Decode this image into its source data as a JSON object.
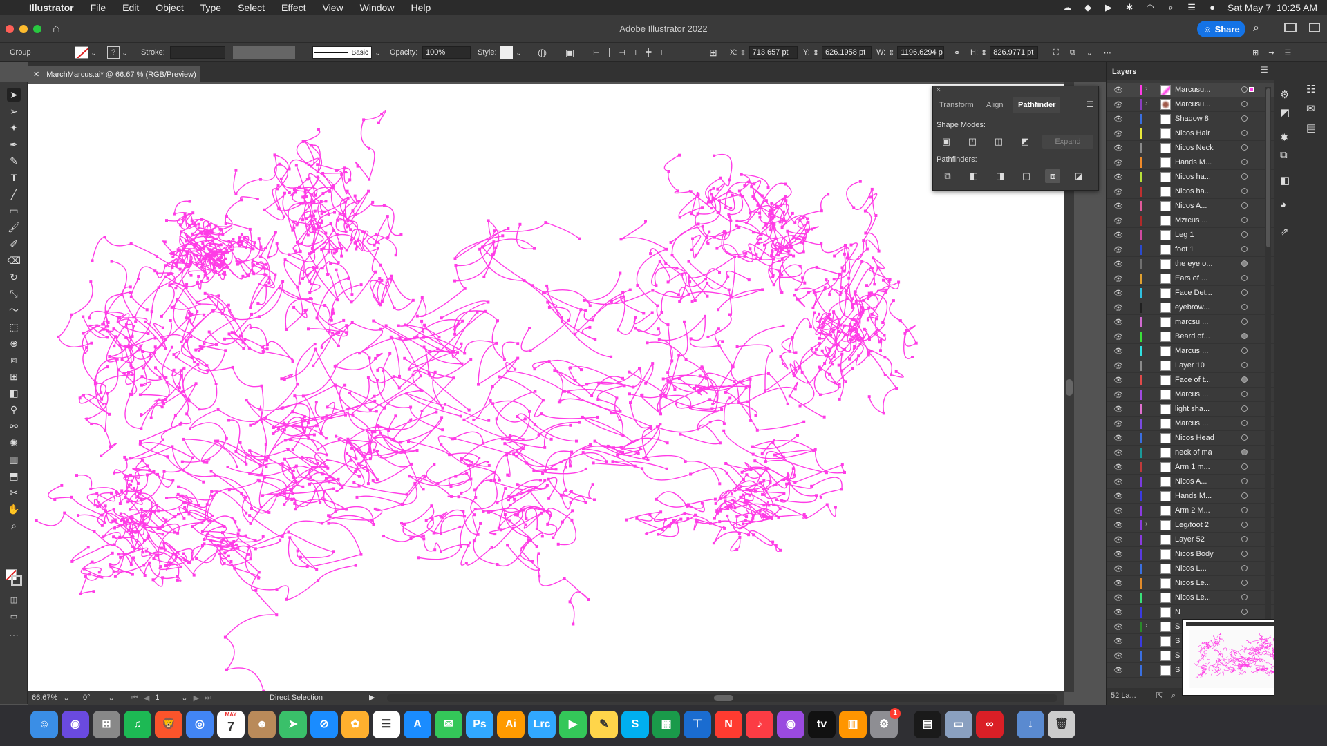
{
  "menubar": {
    "app": "Illustrator",
    "items": [
      "File",
      "Edit",
      "Object",
      "Type",
      "Select",
      "Effect",
      "View",
      "Window",
      "Help"
    ],
    "clock": "Sat May 7  10:25 AM"
  },
  "window": {
    "title": "Adobe Illustrator 2022",
    "share_label": "Share",
    "doc_tab": "MarchMarcus.ai* @ 66.67 % (RGB/Preview)"
  },
  "control": {
    "selection_type": "Group",
    "stroke_label": "Stroke:",
    "brush": "Basic",
    "opacity_label": "Opacity:",
    "opacity": "100%",
    "style_label": "Style:",
    "x_label": "X:",
    "x": "713.657 pt",
    "y_label": "Y:",
    "y": "626.1958 pt",
    "w_label": "W:",
    "w": "1196.6294 p",
    "h_label": "H:",
    "h": "826.9771 pt"
  },
  "pathfinder": {
    "tabs": [
      "Transform",
      "Align",
      "Pathfinder"
    ],
    "active_tab": "Pathfinder",
    "shape_modes_label": "Shape Modes:",
    "expand_label": "Expand",
    "pathfinders_label": "Pathfinders:"
  },
  "layers": {
    "title": "Layers",
    "footer": "52 La...",
    "items": [
      {
        "name": "Marcusu...",
        "color": "#ff3ce6",
        "expanded": true,
        "selected": true,
        "thumb": "art"
      },
      {
        "name": "Marcusu...",
        "color": "#8b3fbf",
        "expanded": true,
        "thumb": "face"
      },
      {
        "name": "Shadow 8",
        "color": "#3a6fe0"
      },
      {
        "name": "Nicos Hair",
        "color": "#e8e83a"
      },
      {
        "name": "Nicos Neck",
        "color": "#8a8a8a"
      },
      {
        "name": "Hands M...",
        "color": "#f08a2a"
      },
      {
        "name": "Nicos ha...",
        "color": "#b8e03a"
      },
      {
        "name": "Nicos ha...",
        "color": "#c03030"
      },
      {
        "name": "Nicos A...",
        "color": "#e05a9a"
      },
      {
        "name": "Mzrcus ...",
        "color": "#b02a2a"
      },
      {
        "name": "Leg 1",
        "color": "#d04aa0"
      },
      {
        "name": "foot 1",
        "color": "#2a4ad0"
      },
      {
        "name": "the eye o...",
        "color": "#707070",
        "filled": true
      },
      {
        "name": "Ears of ...",
        "color": "#e0a030"
      },
      {
        "name": "Face Det...",
        "color": "#30c0e0"
      },
      {
        "name": "eyebrow...",
        "color": "#202020"
      },
      {
        "name": "marcsu ...",
        "color": "#d06ad0"
      },
      {
        "name": "Beard of...",
        "color": "#3ae03a",
        "filled": true
      },
      {
        "name": "Marcus ...",
        "color": "#30e0e0"
      },
      {
        "name": "Layer 10",
        "color": "#8a8a8a"
      },
      {
        "name": "Face of t...",
        "color": "#e04a4a",
        "filled": true
      },
      {
        "name": "Marcus ...",
        "color": "#a04ae0"
      },
      {
        "name": "light sha...",
        "color": "#e070d0"
      },
      {
        "name": "Marcus ...",
        "color": "#7a4ae0"
      },
      {
        "name": "Nicos Head",
        "color": "#3a6fe0"
      },
      {
        "name": "neck of ma",
        "color": "#1a9a9a",
        "filled": true
      },
      {
        "name": "Arm 1 m...",
        "color": "#c03a3a"
      },
      {
        "name": "Nicos A...",
        "color": "#7a3ae0"
      },
      {
        "name": "Hands M...",
        "color": "#3a3ae0"
      },
      {
        "name": "Arm 2 M...",
        "color": "#8a3ae0"
      },
      {
        "name": "Leg/foot 2",
        "color": "#8a3ae0",
        "expanded": true
      },
      {
        "name": "Layer 52",
        "color": "#8a3ae0"
      },
      {
        "name": "Nicos Body",
        "color": "#5a3ae0"
      },
      {
        "name": "Nicos L...",
        "color": "#3a6fe0"
      },
      {
        "name": "Nicos Le...",
        "color": "#e08a2a"
      },
      {
        "name": "Nicos Le...",
        "color": "#3ae07a"
      },
      {
        "name": "N",
        "color": "#3a3ae0"
      },
      {
        "name": "S",
        "color": "#2a8a2a",
        "expanded": true
      },
      {
        "name": "S",
        "color": "#3a3ae0"
      },
      {
        "name": "S",
        "color": "#3a6fe0"
      },
      {
        "name": "S",
        "color": "#3a6fe0"
      }
    ]
  },
  "status": {
    "zoom": "66.67%",
    "rotation": "0°",
    "artboard": "1",
    "tool": "Direct Selection"
  },
  "colors": {
    "artwork": "#ff3ce6",
    "accent": "#1473e6"
  },
  "dock": {
    "apps": [
      "Finder",
      "Siri",
      "Launchpad",
      "Spotify",
      "Brave",
      "Chrome",
      "Calendar",
      "Contacts",
      "Maps",
      "Safari",
      "Photos",
      "Reminders",
      "App Store",
      "Messages",
      "Ps",
      "Ai",
      "Lrc",
      "FaceTime",
      "Notes",
      "Skype",
      "Numbers",
      "Keynote",
      "News",
      "Music",
      "Podcasts",
      "TV",
      "Books",
      "System Preferences",
      "Activity",
      "Preview",
      "Creative Cloud",
      "Downloads",
      "Trash"
    ],
    "calendar_month": "MAY",
    "calendar_day": "7",
    "badge": "1"
  }
}
